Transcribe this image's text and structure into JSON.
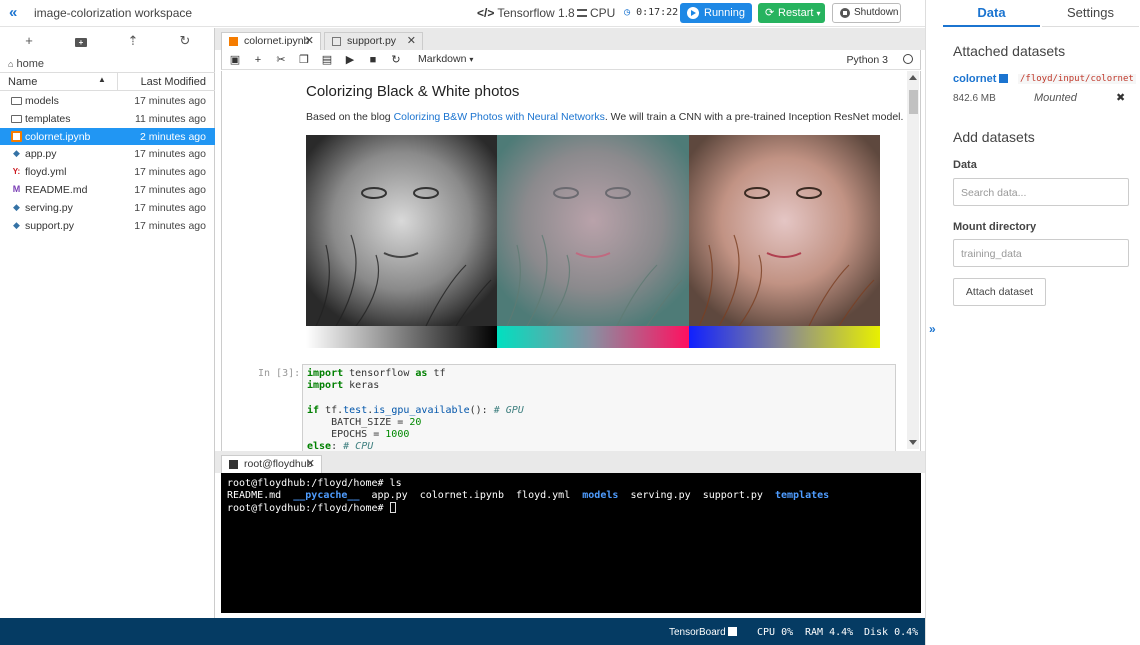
{
  "header": {
    "workspace_title": "image-colorization workspace",
    "environment": "Tensorflow 1.8",
    "machine": "CPU",
    "timer": "0:17:22",
    "run_label": "Running",
    "restart_label": "Restart",
    "shutdown_label": "Shutdown"
  },
  "file_browser": {
    "breadcrumb": "home",
    "columns": {
      "name": "Name",
      "modified": "Last Modified"
    },
    "files": [
      {
        "name": "models",
        "modified": "17 minutes ago",
        "icon": "folder-icon"
      },
      {
        "name": "templates",
        "modified": "11 minutes ago",
        "icon": "folder-icon"
      },
      {
        "name": "colornet.ipynb",
        "modified": "2 minutes ago",
        "icon": "notebook-icon",
        "selected": true
      },
      {
        "name": "app.py",
        "modified": "17 minutes ago",
        "icon": "python-icon"
      },
      {
        "name": "floyd.yml",
        "modified": "17 minutes ago",
        "icon": "yaml-icon"
      },
      {
        "name": "README.md",
        "modified": "17 minutes ago",
        "icon": "markdown-icon"
      },
      {
        "name": "serving.py",
        "modified": "17 minutes ago",
        "icon": "python-icon"
      },
      {
        "name": "support.py",
        "modified": "17 minutes ago",
        "icon": "python-icon"
      }
    ]
  },
  "editor_tabs": [
    {
      "label": "colornet.ipynb",
      "active": true
    },
    {
      "label": "support.py",
      "active": false
    }
  ],
  "notebook": {
    "cell_type": "Markdown",
    "kernel": "Python 3",
    "title": "Colorizing Black & White photos",
    "desc_prefix": "Based on the blog ",
    "desc_link": "Colorizing B&W Photos with Neural Networks",
    "desc_suffix": ". We will train a CNN with a pre-trained Inception ResNet model.",
    "in_prompt": "In [3]:",
    "code": {
      "line1_kw1": "import",
      "line1_mod": " tensorflow ",
      "line1_kw2": "as",
      "line1_alias": " tf",
      "line2_kw": "import",
      "line2_mod": " keras",
      "line4_kw": "if",
      "line4_a": " tf.",
      "line4_b": "test",
      "line4_c": ".",
      "line4_d": "is_gpu_available",
      "line4_e": "(): ",
      "line4_cm": "# GPU",
      "line5_a": "    BATCH_SIZE = ",
      "line5_n": "20",
      "line6_a": "    EPOCHS = ",
      "line6_n": "1000",
      "line7_kw": "else",
      "line7_a": ": ",
      "line7_cm": "# CPU"
    }
  },
  "terminal": {
    "tab_label": "root@floydhub",
    "line1": "root@floydhub:/floyd/home# ls",
    "ls_items": [
      {
        "text": "README.md",
        "dir": false
      },
      {
        "text": "__pycache__",
        "dir": true
      },
      {
        "text": "app.py",
        "dir": false
      },
      {
        "text": "colornet.ipynb",
        "dir": false
      },
      {
        "text": "floyd.yml",
        "dir": false
      },
      {
        "text": "models",
        "dir": true
      },
      {
        "text": "serving.py",
        "dir": false
      },
      {
        "text": "support.py",
        "dir": false
      },
      {
        "text": "templates",
        "dir": true
      }
    ],
    "prompt": "root@floydhub:/floyd/home# "
  },
  "statusbar": {
    "tensorboard": "TensorBoard",
    "cpu": "CPU 0%",
    "ram": "RAM 4.4%",
    "disk": "Disk 0.4%"
  },
  "right_panel": {
    "tabs": {
      "data": "Data",
      "settings": "Settings"
    },
    "attached_heading": "Attached datasets",
    "dataset": {
      "name": "colornet",
      "path": "/floyd/input/colornet",
      "size": "842.6 MB",
      "status": "Mounted"
    },
    "add_heading": "Add datasets",
    "data_label": "Data",
    "data_placeholder": "Search data...",
    "mount_label": "Mount directory",
    "mount_placeholder": "training_data",
    "attach_label": "Attach dataset"
  },
  "colors": {
    "accent": "#1b74d0",
    "running": "#1e88e5",
    "restart": "#27b35f",
    "statusbar": "#053b63",
    "selection": "#2196f3"
  }
}
